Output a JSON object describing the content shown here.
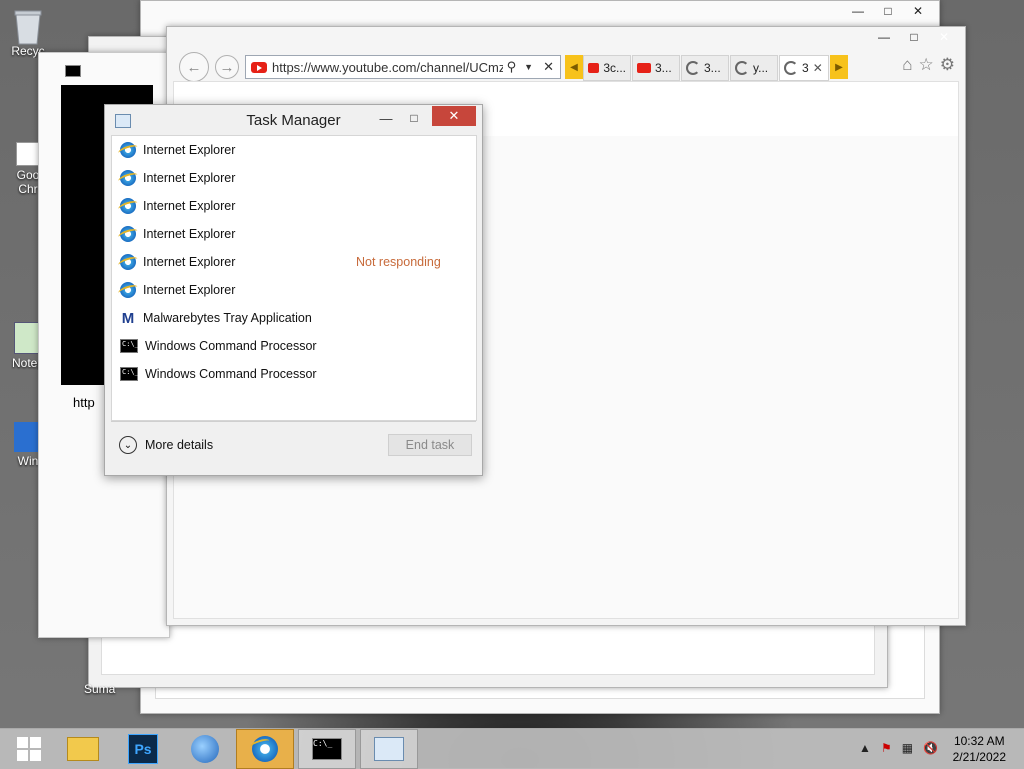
{
  "desktop": {
    "icons": [
      {
        "label": "Recyc"
      },
      {
        "label": "Goo Chr"
      },
      {
        "label": "Notep"
      },
      {
        "label": "Win"
      }
    ],
    "fragment_sum": "Suma"
  },
  "cmd_window": {
    "fragment": "http"
  },
  "ie_window": {
    "url": "https://www.youtube.com/channel/UCmzAl",
    "tabs": [
      {
        "label": "3c...",
        "icon": "youtube-icon"
      },
      {
        "label": "3...",
        "icon": "youtube-icon"
      },
      {
        "label": "3...",
        "icon": "loading-icon"
      },
      {
        "label": "y...",
        "icon": "loading-icon"
      },
      {
        "label": "3",
        "icon": "loading-icon"
      }
    ]
  },
  "task_manager": {
    "title": "Task Manager",
    "processes": [
      {
        "name": "Internet Explorer",
        "icon": "ie-icon",
        "status": ""
      },
      {
        "name": "Internet Explorer",
        "icon": "ie-icon",
        "status": ""
      },
      {
        "name": "Internet Explorer",
        "icon": "ie-icon",
        "status": ""
      },
      {
        "name": "Internet Explorer",
        "icon": "ie-icon",
        "status": ""
      },
      {
        "name": "Internet Explorer",
        "icon": "ie-icon",
        "status": "Not responding"
      },
      {
        "name": "Internet Explorer",
        "icon": "ie-icon",
        "status": ""
      },
      {
        "name": "Malwarebytes Tray Application",
        "icon": "malwarebytes-icon",
        "status": ""
      },
      {
        "name": "Windows Command Processor",
        "icon": "cmd-icon",
        "status": ""
      },
      {
        "name": "Windows Command Processor",
        "icon": "cmd-icon",
        "status": ""
      }
    ],
    "more_details": "More details",
    "end_task": "End task"
  },
  "taskbar": {
    "time": "10:32 AM",
    "date": "2/21/2022"
  },
  "colors": {
    "not_responding": "#c76a3a",
    "close_button": "#c7463b",
    "tab_scroll": "#f7c21b"
  }
}
